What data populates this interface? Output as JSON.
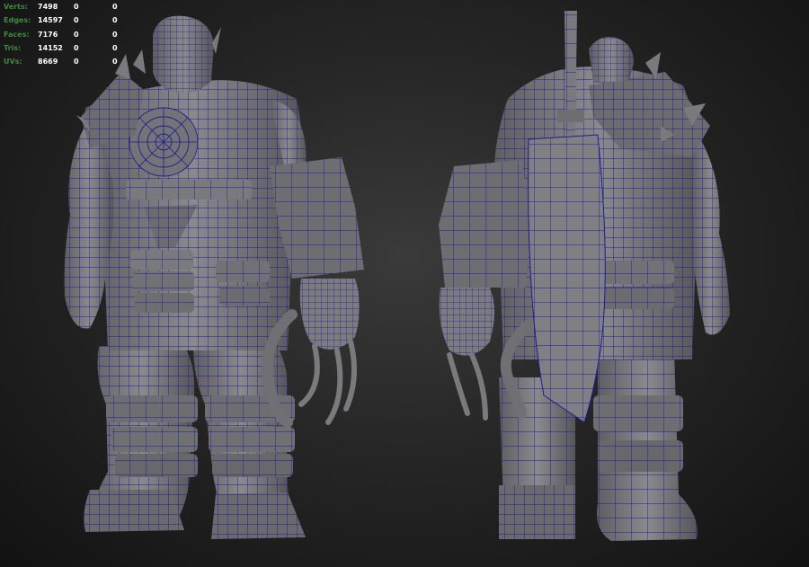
{
  "hud": {
    "rows": [
      {
        "label": "Verts:",
        "value": "7498",
        "a": "0",
        "b": "0"
      },
      {
        "label": "Edges:",
        "value": "14597",
        "a": "0",
        "b": "0"
      },
      {
        "label": "Faces:",
        "value": "7176",
        "a": "0",
        "b": "0"
      },
      {
        "label": "Tris:",
        "value": "14152",
        "a": "0",
        "b": "0"
      },
      {
        "label": "UVs:",
        "value": "8669",
        "a": "0",
        "b": "0"
      }
    ]
  },
  "colors": {
    "background": "#262626",
    "mesh_fill": "#7c7c80",
    "mesh_shadow": "#4a4a4e",
    "wireframe": "#1a1a8c",
    "hud_label": "#3f8a3f",
    "hud_value": "#ffffff"
  },
  "icons": [
    "wireframe-character-front-view",
    "wireframe-character-back-view"
  ]
}
